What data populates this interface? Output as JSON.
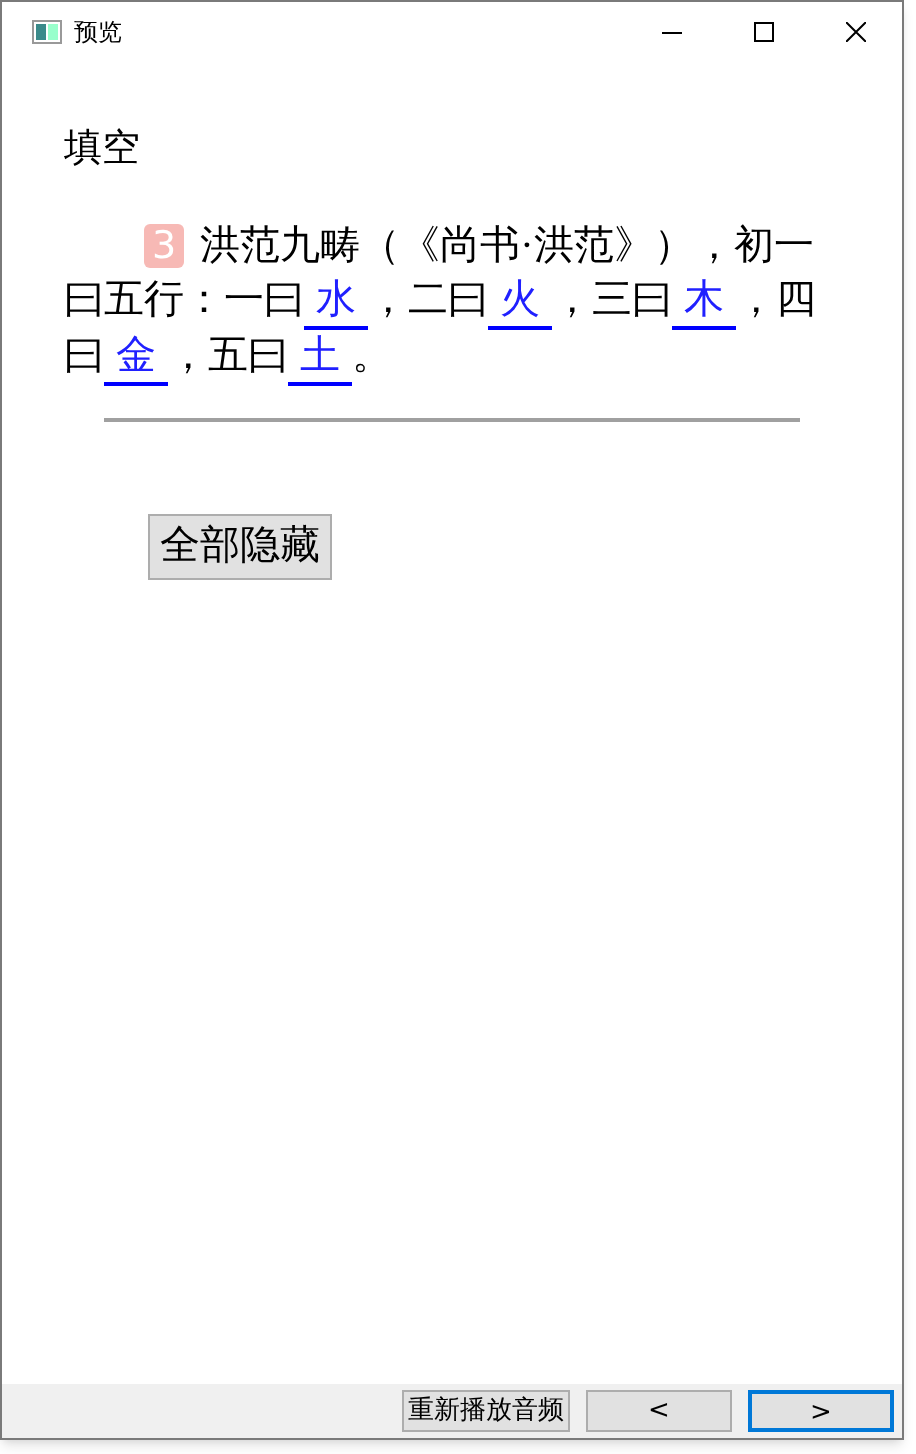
{
  "window": {
    "title": "预览"
  },
  "heading": "填空",
  "question": {
    "number": "3",
    "segments": [
      {
        "kind": "text",
        "text": "洪范九畴（《尚书·洪范》），初一"
      },
      {
        "kind": "text",
        "text": "曰五行：一曰"
      },
      {
        "kind": "blank",
        "text": "水"
      },
      {
        "kind": "text",
        "text": "，二曰"
      },
      {
        "kind": "blank",
        "text": "火"
      },
      {
        "kind": "text",
        "text": "，三曰"
      },
      {
        "kind": "blank",
        "text": "木"
      },
      {
        "kind": "text",
        "text": "，四"
      },
      {
        "kind": "text",
        "text": "曰"
      },
      {
        "kind": "blank",
        "text": "金"
      },
      {
        "kind": "text",
        "text": "，五曰"
      },
      {
        "kind": "blank",
        "text": "土"
      },
      {
        "kind": "text",
        "text": "。"
      }
    ]
  },
  "hide_button": "全部隐藏",
  "footer": {
    "buttons": [
      {
        "label": "重新播放音频",
        "focused": false
      },
      {
        "label": "<",
        "focused": false
      },
      {
        "label": ">",
        "focused": true
      }
    ]
  }
}
